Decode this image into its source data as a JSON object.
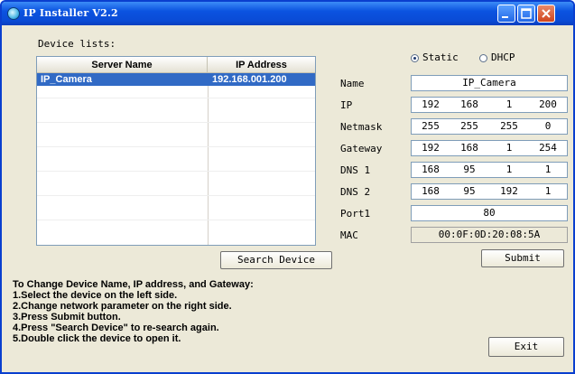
{
  "window": {
    "title": "IP Installer V2.2"
  },
  "device_list": {
    "label": "Device lists:",
    "columns": [
      "Server Name",
      "IP Address"
    ],
    "rows": [
      {
        "name": "IP_Camera",
        "ip": "192.168.001.200"
      }
    ]
  },
  "buttons": {
    "search": "Search Device",
    "submit": "Submit",
    "exit": "Exit"
  },
  "mode": {
    "static_label": "Static",
    "dhcp_label": "DHCP",
    "selected": "Static"
  },
  "fields": {
    "name": {
      "label": "Name",
      "value": "IP_Camera"
    },
    "ip": {
      "label": "IP",
      "values": [
        "192",
        "168",
        "1",
        "200"
      ]
    },
    "netmask": {
      "label": "Netmask",
      "values": [
        "255",
        "255",
        "255",
        "0"
      ]
    },
    "gateway": {
      "label": "Gateway",
      "values": [
        "192",
        "168",
        "1",
        "254"
      ]
    },
    "dns1": {
      "label": "DNS 1",
      "values": [
        "168",
        "95",
        "1",
        "1"
      ]
    },
    "dns2": {
      "label": "DNS 2",
      "values": [
        "168",
        "95",
        "192",
        "1"
      ]
    },
    "port": {
      "label": "Port1",
      "value": "80"
    },
    "mac": {
      "label": "MAC",
      "value": "00:0F:0D:20:08:5A"
    }
  },
  "instructions": {
    "heading": "To Change Device Name, IP address, and Gateway:",
    "steps": [
      "1.Select the device on the left side.",
      "2.Change network parameter on the right side.",
      "3.Press Submit button.",
      "4.Press  \"Search Device\"  to re-search again.",
      "5.Double click the device to open it."
    ]
  },
  "colors": {
    "titlebar": "#0b53e0",
    "selection": "#316ac5",
    "dialog_bg": "#ece9d8"
  },
  "icons": {
    "app": "ip-installer-app-icon",
    "minimize": "minimize-icon",
    "maximize": "maximize-icon",
    "close": "close-icon"
  }
}
